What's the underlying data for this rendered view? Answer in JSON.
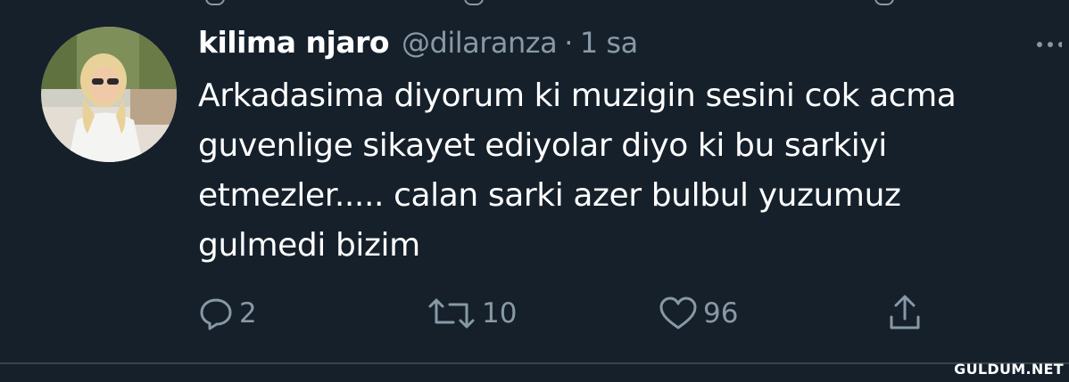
{
  "tweet": {
    "display_name": "kilima njaro",
    "handle": "@dilaranza",
    "separator": "·",
    "timestamp": "1 sa",
    "text": "Arkadasima diyorum ki muzigin sesini cok acma\nguvenlige sikayet ediyolar diyo ki bu sarkiyi\netmezler..... calan sarki azer bulbul yuzumuz\ngulmedi bizim"
  },
  "actions": {
    "reply_count": "2",
    "retweet_count": "10",
    "like_count": "96"
  },
  "icons": {
    "more": "more-dots-icon",
    "reply": "speech-bubble-icon",
    "retweet": "retweet-arrows-icon",
    "like": "heart-icon",
    "share": "share-upload-icon"
  },
  "colors": {
    "background": "#15202b",
    "primary_text": "#ffffff",
    "secondary_text": "#8899a6",
    "divider": "#38444d"
  },
  "watermark": "GULDUM.NET"
}
